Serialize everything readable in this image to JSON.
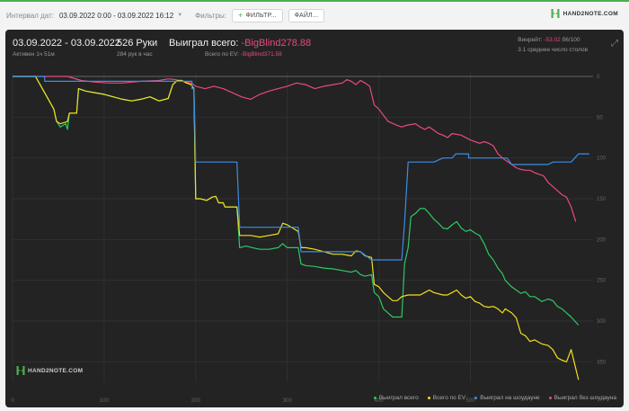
{
  "topbar": {
    "date_label": "Интервал дат:",
    "date_value": "03.09.2022 0:00 - 03.09.2022 16:12",
    "filters_label": "Фильтры:",
    "filter_button": "ФИЛЬТР...",
    "file_button": "ФАЙЛ...",
    "brand": "HAND2NOTE.COM"
  },
  "stats": {
    "period": "03.09.2022 - 03.09.2022",
    "active": "Активен 1ч 51м",
    "hands": "526 Руки",
    "hands_rate": "284 рук в час",
    "won_label": "Выиграл всего:",
    "won_value": "-BigBlind278.88",
    "ev_label": "Всего по EV:",
    "ev_value": "-BigBlind371.58",
    "winrate_label": "Винрейт:",
    "winrate_value": "-53.02",
    "winrate_suffix": "б6/100",
    "tables": "3.1 среднее число столов"
  },
  "watermark": "HAND2NOTE.COM",
  "colors": {
    "accent": "#4caf50",
    "won": "#2ec866",
    "ev": "#f0e020",
    "showdown": "#3a8ee6",
    "non_showdown": "#e84a7a"
  },
  "legend": [
    {
      "label": "Выиграл всего",
      "color": "#2ec866"
    },
    {
      "label": "Всего по EV",
      "color": "#f0e020"
    },
    {
      "label": "Выиграл на шоудауне",
      "color": "#3a8ee6"
    },
    {
      "label": "Выиграл без шоудауна",
      "color": "#e84a7a"
    }
  ],
  "chart_data": {
    "type": "line",
    "xlim": [
      0,
      526
    ],
    "ylim_inverted": [
      0,
      375
    ],
    "x_ticks": [
      0,
      100,
      200,
      300,
      400,
      500
    ],
    "y_ticks": [
      0,
      50,
      100,
      150,
      200,
      250,
      300,
      350
    ],
    "series": [
      {
        "name": "Выиграл всего",
        "color": "#2ec866",
        "points": [
          [
            0,
            0
          ],
          [
            25,
            0
          ],
          [
            30,
            10
          ],
          [
            40,
            30
          ],
          [
            45,
            40
          ],
          [
            48,
            55
          ],
          [
            52,
            62
          ],
          [
            58,
            58
          ],
          [
            60,
            65
          ],
          [
            62,
            45
          ],
          [
            70,
            45
          ],
          [
            72,
            15
          ],
          [
            80,
            18
          ],
          [
            90,
            20
          ],
          [
            100,
            22
          ],
          [
            110,
            25
          ],
          [
            120,
            28
          ],
          [
            130,
            30
          ],
          [
            140,
            28
          ],
          [
            150,
            25
          ],
          [
            160,
            30
          ],
          [
            170,
            27
          ],
          [
            175,
            10
          ],
          [
            180,
            5
          ],
          [
            185,
            5
          ],
          [
            190,
            8
          ],
          [
            195,
            10
          ],
          [
            198,
            15
          ],
          [
            200,
            150
          ],
          [
            205,
            150
          ],
          [
            212,
            152
          ],
          [
            218,
            148
          ],
          [
            222,
            147
          ],
          [
            225,
            155
          ],
          [
            230,
            155
          ],
          [
            232,
            160
          ],
          [
            240,
            160
          ],
          [
            245,
            160
          ],
          [
            248,
            210
          ],
          [
            255,
            208
          ],
          [
            262,
            210
          ],
          [
            270,
            212
          ],
          [
            280,
            212
          ],
          [
            290,
            210
          ],
          [
            295,
            205
          ],
          [
            300,
            210
          ],
          [
            312,
            210
          ],
          [
            315,
            230
          ],
          [
            320,
            232
          ],
          [
            330,
            233
          ],
          [
            340,
            235
          ],
          [
            350,
            236
          ],
          [
            360,
            238
          ],
          [
            370,
            240
          ],
          [
            375,
            238
          ],
          [
            380,
            243
          ],
          [
            385,
            245
          ],
          [
            392,
            243
          ],
          [
            395,
            265
          ],
          [
            400,
            270
          ],
          [
            405,
            285
          ],
          [
            410,
            290
          ],
          [
            415,
            295
          ],
          [
            420,
            295
          ],
          [
            425,
            295
          ],
          [
            428,
            230
          ],
          [
            432,
            210
          ],
          [
            435,
            172
          ],
          [
            440,
            168
          ],
          [
            445,
            162
          ],
          [
            450,
            162
          ],
          [
            455,
            168
          ],
          [
            460,
            175
          ],
          [
            465,
            180
          ],
          [
            470,
            186
          ],
          [
            475,
            187
          ],
          [
            480,
            182
          ],
          [
            485,
            178
          ],
          [
            490,
            186
          ],
          [
            495,
            190
          ],
          [
            500,
            188
          ],
          [
            505,
            192
          ],
          [
            510,
            195
          ],
          [
            515,
            205
          ],
          [
            520,
            218
          ],
          [
            525,
            225
          ],
          [
            530,
            235
          ],
          [
            535,
            242
          ],
          [
            538,
            250
          ],
          [
            545,
            258
          ],
          [
            550,
            262
          ],
          [
            555,
            266
          ],
          [
            560,
            264
          ],
          [
            565,
            270
          ],
          [
            570,
            270
          ],
          [
            578,
            276
          ],
          [
            585,
            273
          ],
          [
            590,
            275
          ],
          [
            595,
            282
          ],
          [
            600,
            285
          ],
          [
            605,
            290
          ],
          [
            610,
            295
          ],
          [
            618,
            305
          ]
        ]
      },
      {
        "name": "Всего по EV",
        "color": "#f0e020",
        "points": [
          [
            0,
            0
          ],
          [
            25,
            0
          ],
          [
            30,
            10
          ],
          [
            40,
            30
          ],
          [
            45,
            40
          ],
          [
            48,
            55
          ],
          [
            52,
            58
          ],
          [
            58,
            56
          ],
          [
            60,
            55
          ],
          [
            62,
            45
          ],
          [
            70,
            45
          ],
          [
            72,
            15
          ],
          [
            80,
            18
          ],
          [
            90,
            20
          ],
          [
            100,
            22
          ],
          [
            110,
            25
          ],
          [
            120,
            28
          ],
          [
            130,
            30
          ],
          [
            140,
            28
          ],
          [
            150,
            25
          ],
          [
            160,
            30
          ],
          [
            170,
            27
          ],
          [
            175,
            10
          ],
          [
            180,
            5
          ],
          [
            185,
            5
          ],
          [
            190,
            8
          ],
          [
            195,
            10
          ],
          [
            198,
            15
          ],
          [
            200,
            150
          ],
          [
            205,
            150
          ],
          [
            212,
            152
          ],
          [
            218,
            148
          ],
          [
            222,
            147
          ],
          [
            225,
            155
          ],
          [
            230,
            155
          ],
          [
            232,
            160
          ],
          [
            240,
            160
          ],
          [
            245,
            160
          ],
          [
            248,
            195
          ],
          [
            260,
            195
          ],
          [
            270,
            197
          ],
          [
            280,
            195
          ],
          [
            290,
            193
          ],
          [
            295,
            180
          ],
          [
            300,
            182
          ],
          [
            312,
            190
          ],
          [
            315,
            210
          ],
          [
            320,
            210
          ],
          [
            330,
            212
          ],
          [
            340,
            215
          ],
          [
            350,
            218
          ],
          [
            360,
            218
          ],
          [
            370,
            220
          ],
          [
            375,
            214
          ],
          [
            380,
            215
          ],
          [
            385,
            220
          ],
          [
            392,
            222
          ],
          [
            395,
            255
          ],
          [
            400,
            258
          ],
          [
            405,
            265
          ],
          [
            410,
            270
          ],
          [
            415,
            275
          ],
          [
            420,
            275
          ],
          [
            425,
            270
          ],
          [
            432,
            268
          ],
          [
            440,
            268
          ],
          [
            445,
            268
          ],
          [
            450,
            265
          ],
          [
            455,
            262
          ],
          [
            460,
            265
          ],
          [
            470,
            268
          ],
          [
            475,
            268
          ],
          [
            480,
            265
          ],
          [
            485,
            262
          ],
          [
            490,
            268
          ],
          [
            495,
            272
          ],
          [
            500,
            270
          ],
          [
            505,
            276
          ],
          [
            510,
            278
          ],
          [
            515,
            282
          ],
          [
            520,
            283
          ],
          [
            525,
            282
          ],
          [
            530,
            285
          ],
          [
            535,
            290
          ],
          [
            538,
            285
          ],
          [
            545,
            290
          ],
          [
            550,
            296
          ],
          [
            555,
            315
          ],
          [
            560,
            318
          ],
          [
            565,
            325
          ],
          [
            570,
            323
          ],
          [
            578,
            328
          ],
          [
            585,
            330
          ],
          [
            590,
            335
          ],
          [
            595,
            345
          ],
          [
            600,
            348
          ],
          [
            605,
            350
          ],
          [
            610,
            335
          ],
          [
            618,
            372
          ]
        ]
      },
      {
        "name": "Выиграл на шоудауне",
        "color": "#3a8ee6",
        "points": [
          [
            0,
            0
          ],
          [
            35,
            0
          ],
          [
            35,
            6
          ],
          [
            196,
            6
          ],
          [
            196,
            15
          ],
          [
            198,
            15
          ],
          [
            200,
            105
          ],
          [
            245,
            105
          ],
          [
            248,
            185
          ],
          [
            312,
            185
          ],
          [
            315,
            215
          ],
          [
            380,
            215
          ],
          [
            392,
            225
          ],
          [
            425,
            225
          ],
          [
            428,
            180
          ],
          [
            432,
            105
          ],
          [
            460,
            105
          ],
          [
            470,
            100
          ],
          [
            480,
            100
          ],
          [
            484,
            95
          ],
          [
            498,
            95
          ],
          [
            498,
            100
          ],
          [
            540,
            100
          ],
          [
            545,
            108
          ],
          [
            560,
            108
          ],
          [
            570,
            108
          ],
          [
            585,
            108
          ],
          [
            590,
            105
          ],
          [
            610,
            105
          ],
          [
            618,
            95
          ],
          [
            630,
            95
          ]
        ]
      },
      {
        "name": "Выиграл без шоудауна",
        "color": "#e84a7a",
        "points": [
          [
            0,
            0
          ],
          [
            60,
            0
          ],
          [
            75,
            5
          ],
          [
            90,
            7
          ],
          [
            105,
            8
          ],
          [
            120,
            8
          ],
          [
            140,
            6
          ],
          [
            160,
            5
          ],
          [
            170,
            3
          ],
          [
            178,
            4
          ],
          [
            185,
            6
          ],
          [
            195,
            8
          ],
          [
            200,
            12
          ],
          [
            210,
            15
          ],
          [
            220,
            12
          ],
          [
            230,
            15
          ],
          [
            240,
            20
          ],
          [
            250,
            25
          ],
          [
            260,
            28
          ],
          [
            270,
            22
          ],
          [
            280,
            18
          ],
          [
            290,
            15
          ],
          [
            300,
            12
          ],
          [
            310,
            8
          ],
          [
            320,
            10
          ],
          [
            330,
            15
          ],
          [
            340,
            12
          ],
          [
            350,
            10
          ],
          [
            360,
            8
          ],
          [
            365,
            4
          ],
          [
            370,
            6
          ],
          [
            375,
            10
          ],
          [
            380,
            5
          ],
          [
            385,
            8
          ],
          [
            390,
            12
          ],
          [
            395,
            35
          ],
          [
            400,
            40
          ],
          [
            410,
            55
          ],
          [
            420,
            60
          ],
          [
            425,
            62
          ],
          [
            430,
            60
          ],
          [
            440,
            58
          ],
          [
            445,
            62
          ],
          [
            450,
            65
          ],
          [
            455,
            62
          ],
          [
            460,
            66
          ],
          [
            465,
            70
          ],
          [
            470,
            72
          ],
          [
            475,
            75
          ],
          [
            480,
            70
          ],
          [
            490,
            72
          ],
          [
            500,
            78
          ],
          [
            505,
            80
          ],
          [
            510,
            82
          ],
          [
            515,
            80
          ],
          [
            520,
            82
          ],
          [
            525,
            85
          ],
          [
            530,
            95
          ],
          [
            535,
            100
          ],
          [
            545,
            108
          ],
          [
            550,
            112
          ],
          [
            555,
            114
          ],
          [
            560,
            115
          ],
          [
            565,
            115
          ],
          [
            570,
            118
          ],
          [
            575,
            120
          ],
          [
            580,
            122
          ],
          [
            585,
            130
          ],
          [
            590,
            135
          ],
          [
            595,
            140
          ],
          [
            600,
            145
          ],
          [
            605,
            148
          ],
          [
            610,
            160
          ],
          [
            615,
            178
          ]
        ]
      }
    ]
  }
}
